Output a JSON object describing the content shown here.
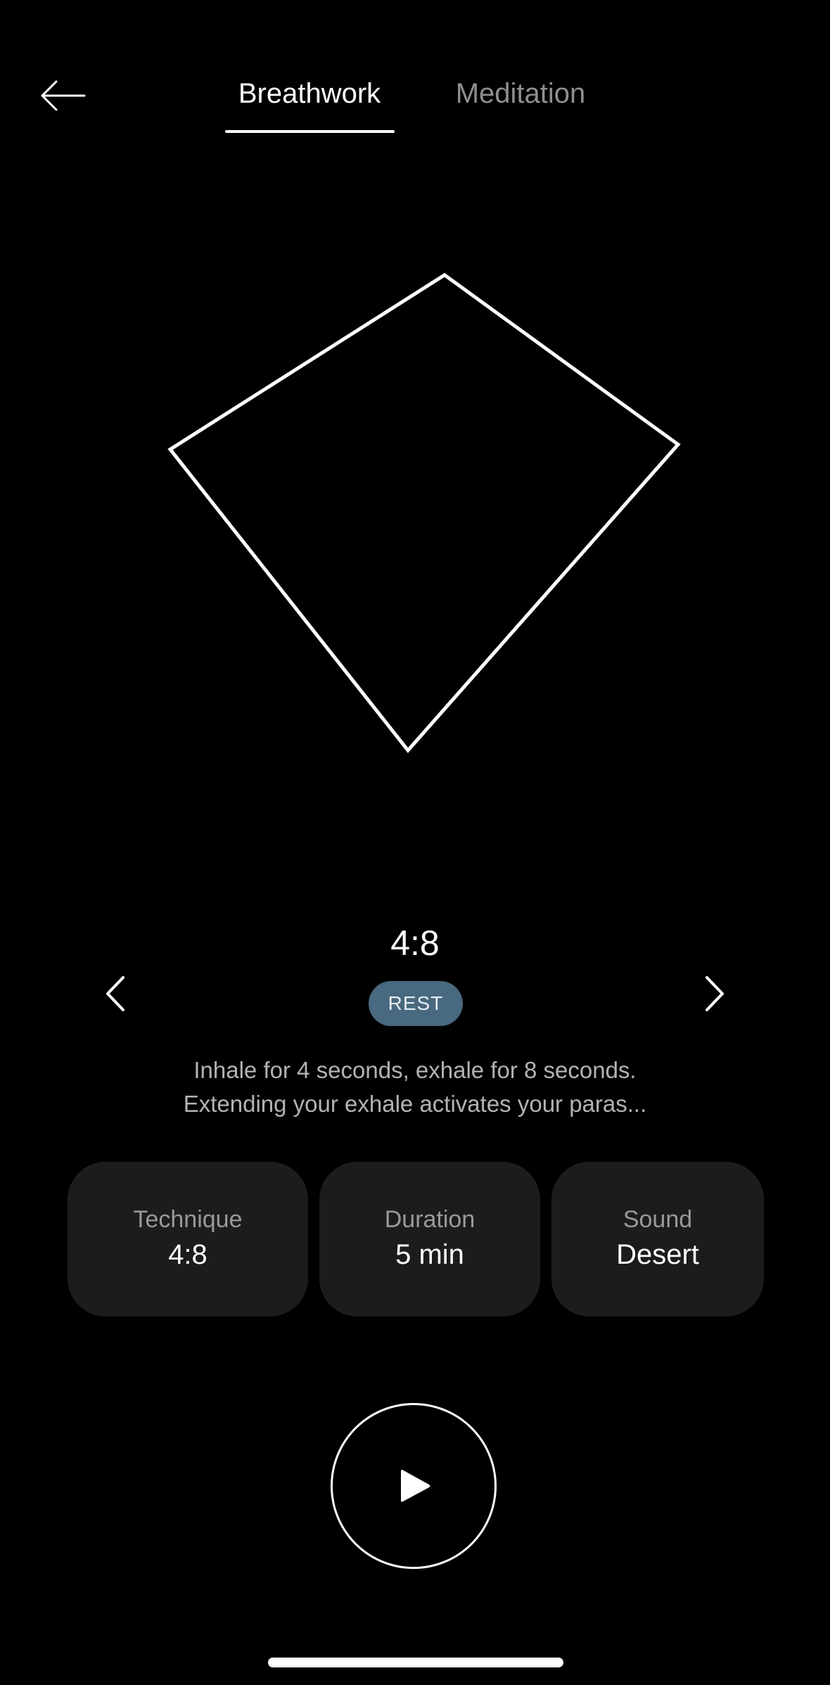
{
  "header": {
    "back_icon": "arrow-left-icon",
    "tabs": [
      {
        "label": "Breathwork",
        "active": true
      },
      {
        "label": "Meditation",
        "active": false
      }
    ]
  },
  "visual": {
    "shape": "breathing-quadrilateral-outline",
    "stroke_color": "#ffffff"
  },
  "pattern": {
    "ratio": "4:8",
    "phase": "REST",
    "prev_icon": "chevron-left-icon",
    "next_icon": "chevron-right-icon"
  },
  "description": {
    "line1": "Inhale for 4 seconds, exhale for 8 seconds.",
    "line2": "Extending your exhale activates your paras..."
  },
  "settings": {
    "technique": {
      "label": "Technique",
      "value": "4:8"
    },
    "duration": {
      "label": "Duration",
      "value": "5 min"
    },
    "sound": {
      "label": "Sound",
      "value": "Desert"
    }
  },
  "controls": {
    "play_icon": "play-icon"
  },
  "colors": {
    "background": "#000000",
    "badge": "#48697f",
    "card": "#1c1c1c",
    "muted_text": "#9a9a9a"
  }
}
